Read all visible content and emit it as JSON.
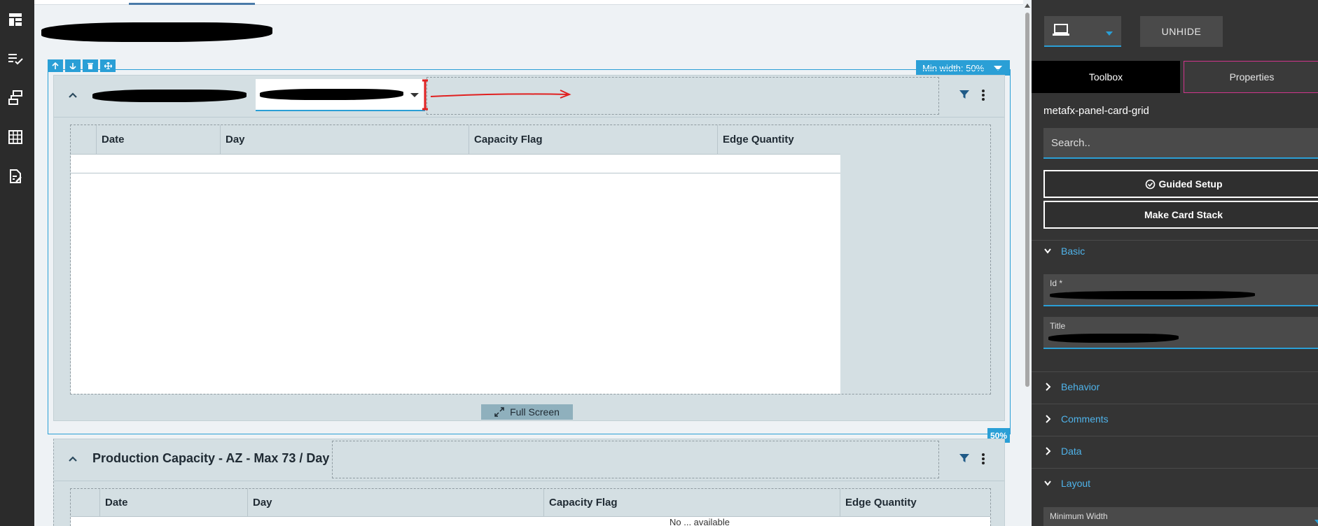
{
  "nav_rail": {
    "icons": [
      "layout-icon",
      "checklist-icon",
      "workflow-icon",
      "table-icon",
      "edit-document-icon"
    ]
  },
  "canvas": {
    "selection": {
      "min_width_label": "Min width: 50%",
      "width_badge": "50%",
      "tools": [
        "↑",
        "↓",
        "🗑",
        "✥"
      ]
    },
    "card1": {
      "columns": [
        "Date",
        "Day",
        "Capacity Flag",
        "Edge Quantity"
      ],
      "fullscreen_label": "Full Screen"
    },
    "card2": {
      "title": "Production Capacity - AZ - Max 73 / Day",
      "columns": [
        "Date",
        "Day",
        "Capacity Flag",
        "Edge Quantity"
      ],
      "no_data": "No ... available"
    }
  },
  "panel": {
    "unhide_label": "UNHIDE",
    "tabs": [
      {
        "label": "Toolbox",
        "active": true
      },
      {
        "label": "Properties",
        "active": false
      }
    ],
    "component_name": "metafx-panel-card-grid",
    "search_placeholder": "Search..",
    "guided_setup_label": "Guided Setup",
    "card_stack_label": "Make Card Stack",
    "sections": {
      "basic": "Basic",
      "behavior": "Behavior",
      "comments": "Comments",
      "data": "Data",
      "layout": "Layout"
    },
    "fields": {
      "id_label": "Id *",
      "title_label": "Title",
      "min_width_label": "Minimum Width"
    }
  },
  "colors": {
    "accent": "#2a9fd6",
    "rail": "#2b2b2b",
    "panel": "#343434",
    "card": "#d4dfe3",
    "annotation": "#e02020"
  }
}
